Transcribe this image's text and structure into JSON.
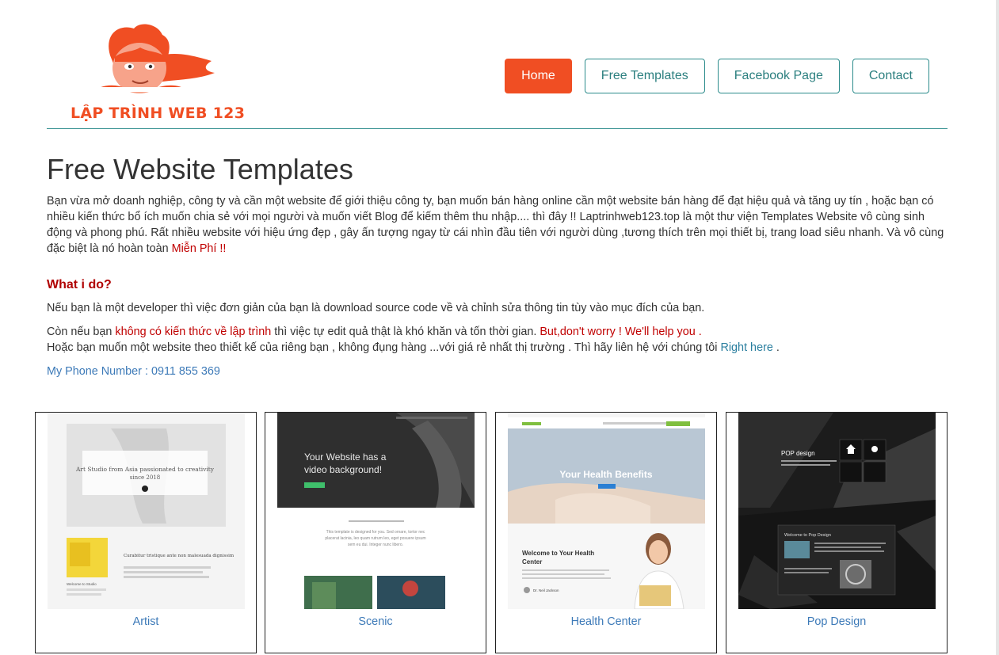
{
  "logo": {
    "text": "LẬP TRÌNH WEB 123"
  },
  "nav": {
    "home": "Home",
    "free_templates": "Free Templates",
    "facebook_page": "Facebook Page",
    "contact": "Contact"
  },
  "main": {
    "title": "Free Website Templates",
    "intro": "Bạn vừa mở doanh nghiệp, công ty và cần một website để giới thiệu công ty, bạn muốn bán hàng online cần một website bán hàng để đạt hiệu quả và tăng uy tín , hoặc bạn có nhiều kiến thức bổ ích muốn chia sẻ với mọi người và muốn viết Blog để kiếm thêm thu nhập.... thì đây !! Laptrinhweb123.top là một thư viện Templates Website vô cùng sinh động và phong phú. Rất nhiều website với hiệu ứng đẹp , gây ấn tượng ngay từ cái nhìn đầu tiên với người dùng ,tương thích trên mọi thiết bị, trang load siêu nhanh. Và vô cùng đặc biệt là nó hoàn toàn",
    "intro_highlight": "Miễn Phí !!",
    "what_heading": "What i do?",
    "para1": "Nếu bạn là một developer thì việc đơn giản của bạn là download source code về và chỉnh sửa thông tin tùy vào mục đích của bạn.",
    "para2_a": "Còn nếu bạn",
    "para2_red1": "không có kiến thức về lập trình",
    "para2_b": "thì việc tự edit quả thật là khó khăn và tốn thời gian.",
    "para2_red2": "But,don't worry ! We'll help you .",
    "para3_a": "Hoặc bạn muốn một website theo thiết kế của riêng bạn , không đụng hàng ...với giá rẻ nhất thị trường . Thì hãy liên hệ với chúng tôi",
    "para3_link": "Right here",
    "para3_b": ".",
    "phone": "My Phone Number : 0911 855 369"
  },
  "templates": [
    {
      "label": "Artist",
      "thumb_text": [
        "Art Studio from Asia passionated to creativity",
        "since 2018",
        "Curabitur tristique ante non malesuada dignissim",
        "Welcome to Studio"
      ]
    },
    {
      "label": "Scenic",
      "thumb_text": [
        "Your Website has a",
        "video background!",
        "This template is designed for you. Sed ornare, tortor nec",
        "placerat lacinia, leo quam rutrum leo, eget posuere ipsum",
        "sem eu dui. Integer nunc libero."
      ]
    },
    {
      "label": "Health Center",
      "thumb_text": [
        "Your Health Benefits",
        "Welcome to Your Health",
        "Center",
        "Dr. Neil Jackson"
      ]
    },
    {
      "label": "Pop Design",
      "thumb_text": [
        "POP design",
        "Welcome to Pop Design"
      ]
    }
  ],
  "colors": {
    "accent": "#f04e23",
    "teal": "#2b8b8b",
    "link": "#3d7ab8",
    "highlight_red": "#c00000"
  }
}
